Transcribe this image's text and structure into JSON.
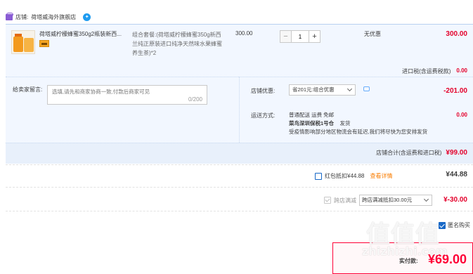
{
  "store": {
    "prefix": "店铺:",
    "name": "荷塔威海外旗舰店"
  },
  "item": {
    "title": "荷塔威柠檬蜂蜜350g2瓶装新西...",
    "sku": "组合套餐:(荷塔威柠檬蜂蜜350g新西兰纯正原装进口纯净天然味水果蜂蜜养生茶)*2",
    "unit_price": "300.00",
    "quantity": "1",
    "qty_minus": "−",
    "qty_plus": "+",
    "discount_text": "无优惠",
    "line_total": "300.00"
  },
  "import_tax": {
    "label": "进口税(含运费税款)",
    "value": "0.00"
  },
  "message": {
    "label": "给卖家留言:",
    "placeholder": "选填,请先和商家协商一致,付款后商家可见",
    "counter": "0/200"
  },
  "coupon": {
    "label": "店铺优惠:",
    "selected": "省201元:组合优惠",
    "value": "-201.00"
  },
  "shipping": {
    "label": "运送方式:",
    "line1": "普通配送 运费 免邮",
    "warehouse": "菜鸟深圳保税1号仓",
    "ship_text": "发货",
    "notice": "受疫情影响部分地区物流会有延迟,我们将尽快为您安排发货",
    "value": "0.00"
  },
  "store_total": {
    "label": "店铺合计(含运费和进口税)",
    "value": "¥99.00"
  },
  "redpack": {
    "label": "红包抵扣¥44.88",
    "link": "查看详情",
    "amount": "¥44.88"
  },
  "cross_store": {
    "label": "跨店满减",
    "selected": "跨店满减抵扣30.00元",
    "amount": "¥-30.00"
  },
  "anonymous": {
    "label": "匿名购买"
  },
  "payment": {
    "label": "实付款:",
    "value": "¥69.00"
  },
  "watermark": {
    "glyphs": "值值值",
    "domain": "zhizhizhi.com"
  }
}
